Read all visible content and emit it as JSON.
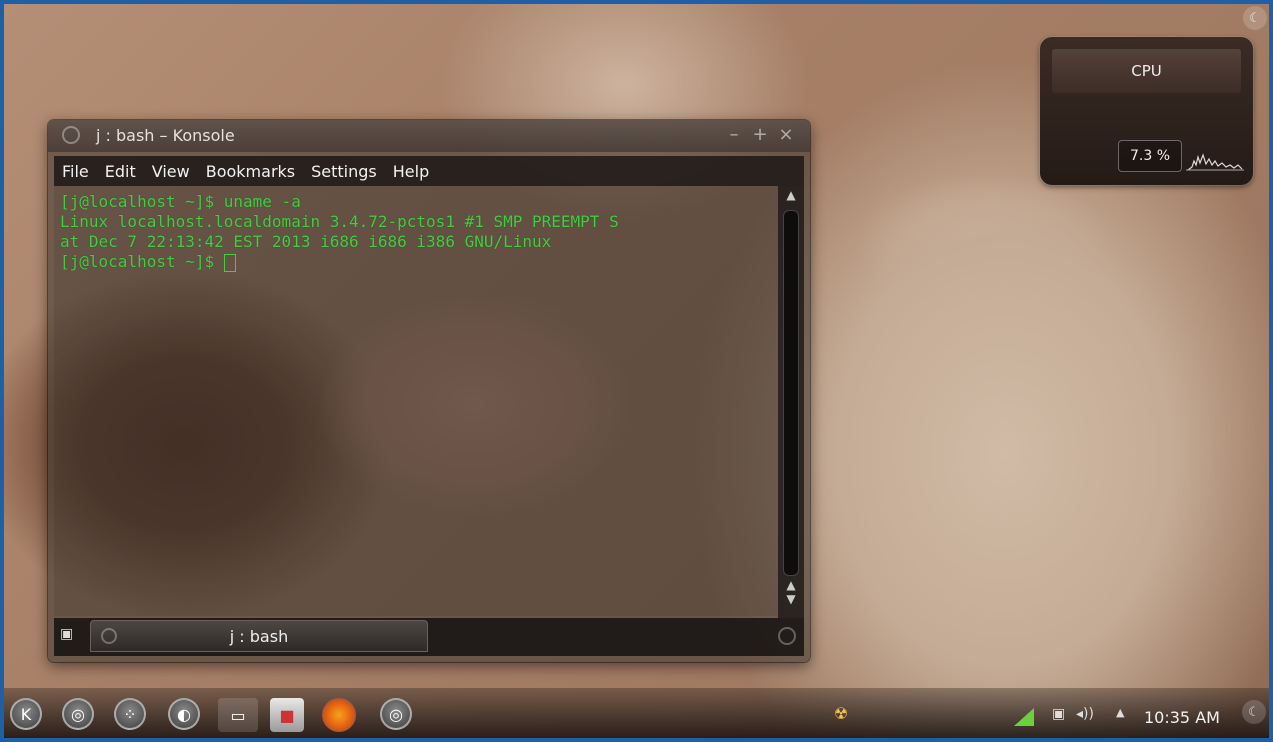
{
  "desktop": {
    "cpu_widget": {
      "title": "CPU",
      "value": "7.3 %"
    }
  },
  "konsole": {
    "title": "j : bash – Konsole",
    "menu": [
      "File",
      "Edit",
      "View",
      "Bookmarks",
      "Settings",
      "Help"
    ],
    "terminal_lines": [
      "[j@localhost ~]$ uname -a",
      "Linux localhost.localdomain 3.4.72-pctos1 #1 SMP PREEMPT S",
      "at Dec 7 22:13:42 EST 2013 i686 i686 i386 GNU/Linux",
      "[j@localhost ~]$ "
    ],
    "tab_label": "j : bash",
    "text_color": "#3fcf3f"
  },
  "panel": {
    "launchers": [
      "kde-menu-icon",
      "activities-icon",
      "desktop-icon",
      "circle-app-icon",
      "device-notifier-icon",
      "package-icon",
      "firefox-icon",
      "circle-app-icon"
    ],
    "clock": "10:35 AM",
    "tray": [
      "network-signal-icon",
      "battery-icon",
      "volume-icon",
      "expand-arrow-icon"
    ]
  }
}
